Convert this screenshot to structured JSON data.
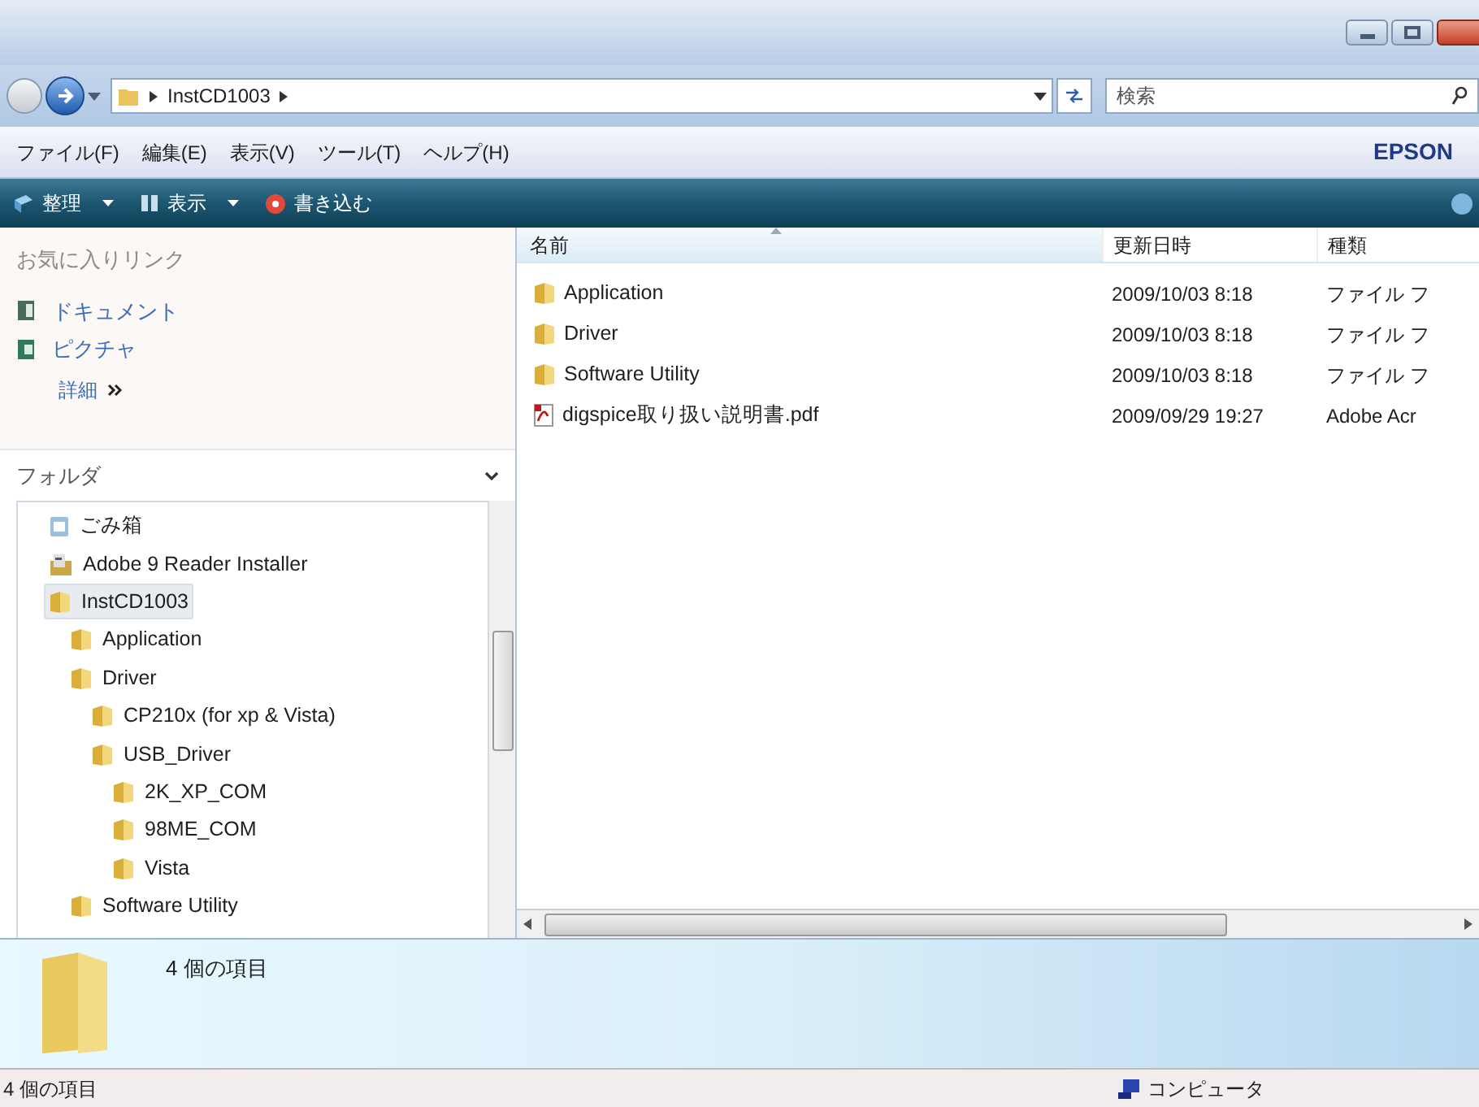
{
  "address_bar": {
    "path": "InstCD1003"
  },
  "search": {
    "placeholder": "検索"
  },
  "menu": [
    "ファイル(F)",
    "編集(E)",
    "表示(V)",
    "ツール(T)",
    "ヘルプ(H)"
  ],
  "brand": "EPSON",
  "toolbar": [
    {
      "label": "整理",
      "kind": "organize"
    },
    {
      "label": "表示",
      "kind": "views"
    },
    {
      "label": "書き込む",
      "kind": "burn"
    }
  ],
  "favorites": {
    "title": "お気に入りリンク",
    "items": [
      {
        "label": "ドキュメント",
        "kind": "documents"
      },
      {
        "label": "ピクチャ",
        "kind": "pictures"
      }
    ],
    "more": "詳細"
  },
  "folders": {
    "title": "フォルダ",
    "tree": [
      {
        "label": "ごみ箱",
        "kind": "recycle",
        "selected": false
      },
      {
        "label": "Adobe 9 Reader Installer",
        "kind": "installer",
        "selected": false
      },
      {
        "label": "InstCD1003",
        "kind": "folder",
        "selected": true,
        "children": [
          {
            "label": "Application",
            "kind": "folder",
            "selected": false
          },
          {
            "label": "Driver",
            "kind": "folder",
            "selected": false,
            "children": [
              {
                "label": "CP210x (for xp & Vista)",
                "kind": "folder",
                "selected": false
              },
              {
                "label": "USB_Driver",
                "kind": "folder",
                "selected": false,
                "children": [
                  {
                    "label": "2K_XP_COM",
                    "kind": "folder",
                    "selected": false
                  },
                  {
                    "label": "98ME_COM",
                    "kind": "folder",
                    "selected": false
                  },
                  {
                    "label": "Vista",
                    "kind": "folder",
                    "selected": false
                  }
                ]
              }
            ]
          },
          {
            "label": "Software Utility",
            "kind": "folder",
            "selected": false
          }
        ]
      }
    ]
  },
  "table": {
    "columns": [
      "名前",
      "更新日時",
      "種類"
    ],
    "rows": [
      {
        "kind": "folder",
        "name": "Application",
        "modified": "2009/10/03 8:18",
        "type": "ファイル フ"
      },
      {
        "kind": "folder",
        "name": "Driver",
        "modified": "2009/10/03 8:18",
        "type": "ファイル フ"
      },
      {
        "kind": "folder",
        "name": "Software Utility",
        "modified": "2009/10/03 8:18",
        "type": "ファイル フ"
      },
      {
        "kind": "pdf",
        "name": "digspice取り扱い説明書.pdf",
        "modified": "2009/09/29 19:27",
        "type": "Adobe Acr"
      }
    ]
  },
  "details": {
    "count": "4 個の項目"
  },
  "status_bar": {
    "left": "4 個の項目",
    "right": "コンピュータ"
  }
}
